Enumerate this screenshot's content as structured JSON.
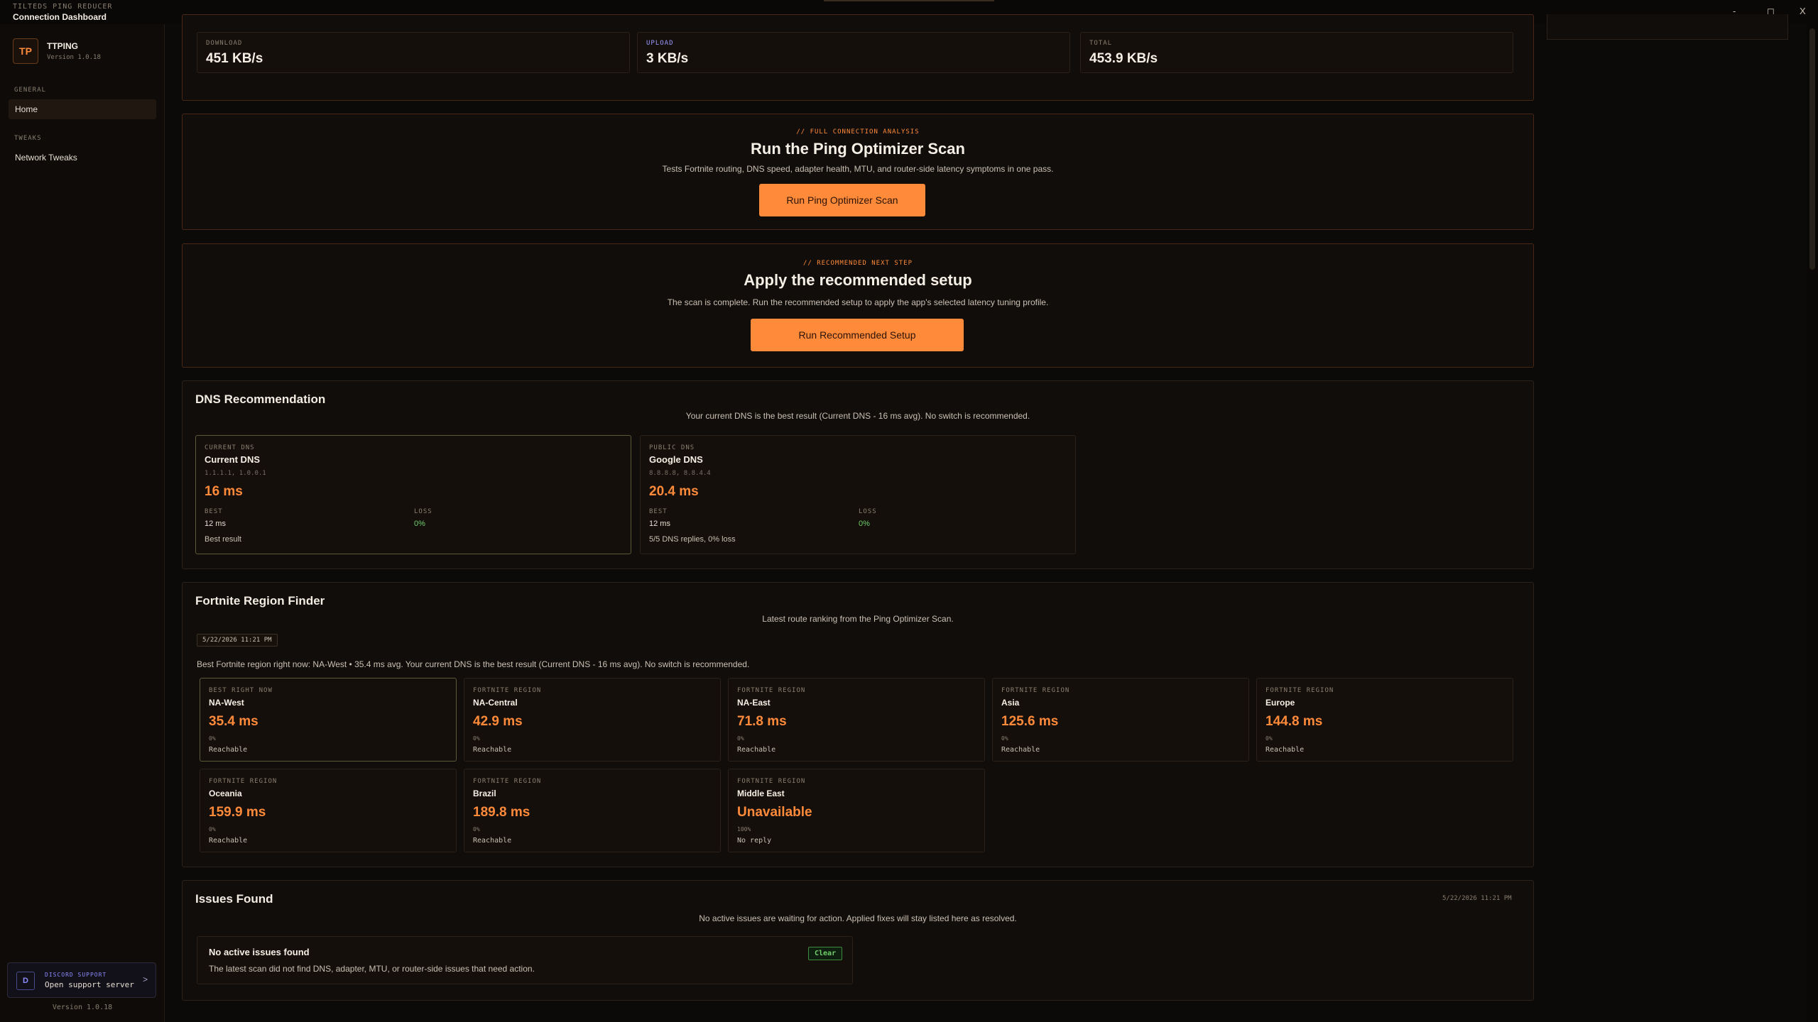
{
  "titlebar": {
    "small": "TILTEDS PING REDUCER",
    "title": "Connection Dashboard",
    "min": "-",
    "max": "◻",
    "close": "X"
  },
  "sidebar": {
    "brand": {
      "logo": "TP",
      "name": "TTPING",
      "version": "Version 1.0.18"
    },
    "sections": [
      {
        "label": "GENERAL",
        "items": [
          {
            "label": "Home",
            "active": true
          }
        ]
      },
      {
        "label": "TWEAKS",
        "items": [
          {
            "label": "Network Tweaks",
            "active": false
          }
        ]
      }
    ],
    "discord": {
      "icon": "D",
      "small": "DISCORD SUPPORT",
      "label": "Open support server",
      "chevron": ">"
    },
    "footer": "Version 1.0.18"
  },
  "stats": [
    {
      "label": "DOWNLOAD",
      "value": "451 KB/s"
    },
    {
      "label": "UPLOAD",
      "value": "3 KB/s"
    },
    {
      "label": "TOTAL",
      "value": "453.9 KB/s"
    }
  ],
  "scan": {
    "tag": "// FULL CONNECTION ANALYSIS",
    "title": "Run the Ping Optimizer Scan",
    "desc": "Tests Fortnite routing, DNS speed, adapter health, MTU, and router-side latency symptoms in one pass.",
    "button": "Run Ping Optimizer Scan"
  },
  "recommend": {
    "tag": "// RECOMMENDED NEXT STEP",
    "title": "Apply the recommended setup",
    "desc": "The scan is complete. Run the recommended setup to apply the app's selected latency tuning profile.",
    "button": "Run Recommended Setup"
  },
  "dns": {
    "title": "DNS Recommendation",
    "summary": "Your current DNS is the best result (Current DNS - 16 ms avg). No switch is recommended.",
    "best_label": "BEST",
    "loss_label": "LOSS",
    "items": [
      {
        "label": "CURRENT DNS",
        "name": "Current DNS",
        "ip": "1.1.1.1, 1.0.0.1",
        "ms": "16 ms",
        "best": "12 ms",
        "loss": "0%",
        "note": "Best result"
      },
      {
        "label": "PUBLIC DNS",
        "name": "Google DNS",
        "ip": "8.8.8.8, 8.8.4.4",
        "ms": "20.4 ms",
        "best": "12 ms",
        "loss": "0%",
        "note": "5/5 DNS replies, 0% loss"
      }
    ]
  },
  "regions": {
    "title": "Fortnite Region Finder",
    "subtitle": "Latest route ranking from the Ping Optimizer Scan.",
    "date": "5/22/2026 11:21 PM",
    "best_line": "Best Fortnite region right now: NA-West • 35.4 ms avg. Your current DNS is the best result (Current DNS - 16 ms avg). No switch is recommended.",
    "items": [
      {
        "label": "BEST RIGHT NOW",
        "name": "NA-West",
        "ms": "35.4 ms",
        "loss": "0%",
        "status": "Reachable"
      },
      {
        "label": "FORTNITE REGION",
        "name": "NA-Central",
        "ms": "42.9 ms",
        "loss": "0%",
        "status": "Reachable"
      },
      {
        "label": "FORTNITE REGION",
        "name": "NA-East",
        "ms": "71.8 ms",
        "loss": "0%",
        "status": "Reachable"
      },
      {
        "label": "FORTNITE REGION",
        "name": "Asia",
        "ms": "125.6 ms",
        "loss": "0%",
        "status": "Reachable"
      },
      {
        "label": "FORTNITE REGION",
        "name": "Europe",
        "ms": "144.8 ms",
        "loss": "0%",
        "status": "Reachable"
      },
      {
        "label": "FORTNITE REGION",
        "name": "Oceania",
        "ms": "159.9 ms",
        "loss": "0%",
        "status": "Reachable"
      },
      {
        "label": "FORTNITE REGION",
        "name": "Brazil",
        "ms": "189.8 ms",
        "loss": "0%",
        "status": "Reachable"
      },
      {
        "label": "FORTNITE REGION",
        "name": "Middle East",
        "ms": "Unavailable",
        "loss": "100%",
        "status": "No reply"
      }
    ]
  },
  "issues": {
    "title": "Issues Found",
    "date": "5/22/2026 11:21 PM",
    "summary": "No active issues are waiting for action. Applied fixes will stay listed here as resolved.",
    "item": {
      "title": "No active issues found",
      "desc": "The latest scan did not find DNS, adapter, MTU, or router-side issues that need action.",
      "badge": "Clear"
    }
  },
  "colors": {
    "accent": "#ff8a3a",
    "background": "#0c0a08",
    "card": "#110d0a",
    "success": "#6fcf6a",
    "upload": "#9a9aff"
  }
}
